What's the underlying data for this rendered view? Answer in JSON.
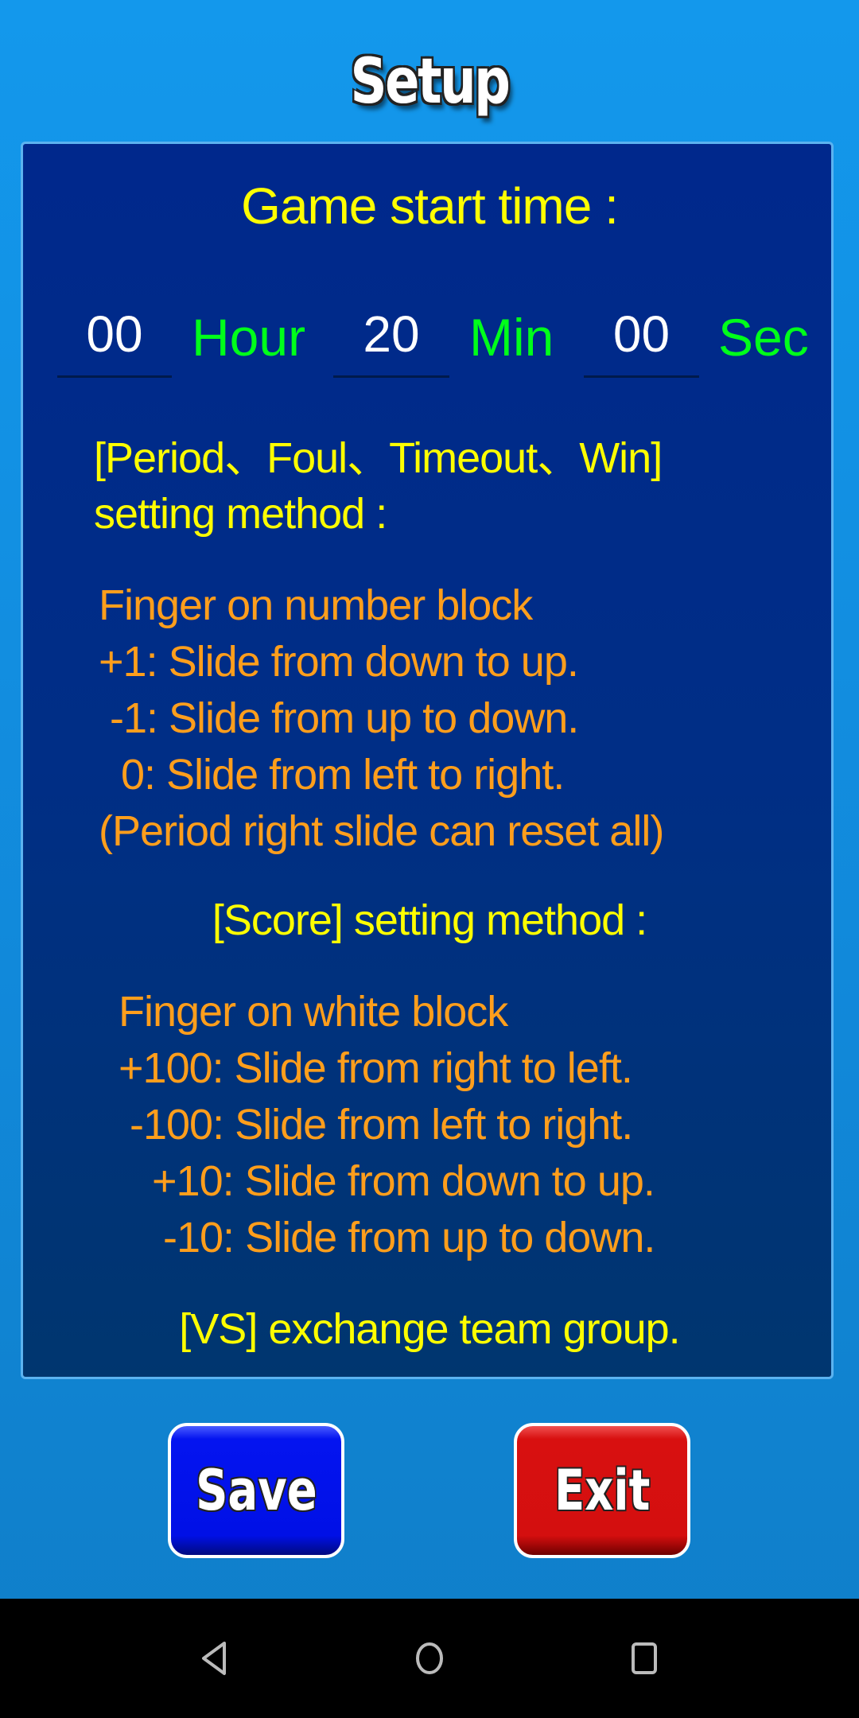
{
  "title": "Setup",
  "start_time": {
    "label": "Game start time :",
    "hour_value": "00",
    "hour_label": "Hour",
    "min_value": "20",
    "min_label": "Min",
    "sec_value": "00",
    "sec_label": "Sec"
  },
  "number_method": {
    "heading_line1": "[Period、Foul、Timeout、Win]",
    "heading_line2": "setting method :",
    "lines": [
      "Finger on number block",
      "+1: Slide from down to up.",
      " -1: Slide from up to down.",
      "  0: Slide from left to right.",
      "(Period right slide can reset all)"
    ]
  },
  "score_method": {
    "heading": "[Score] setting method :",
    "lines": [
      "Finger on white block",
      "+100: Slide from right to left.",
      " -100: Slide from left to right.",
      "   +10: Slide from down to up.",
      "    -10: Slide from up to down."
    ]
  },
  "vs_note": "[VS] exchange team group.",
  "buttons": {
    "save": "Save",
    "exit": "Exit"
  },
  "colors": {
    "heading": "#ffff00",
    "unit": "#00ff1a",
    "instructions": "#ff9e1c",
    "save": "#0010e6",
    "exit": "#d40f0f"
  },
  "navbar": {
    "icons": [
      "back-icon",
      "home-icon",
      "recents-icon"
    ]
  }
}
